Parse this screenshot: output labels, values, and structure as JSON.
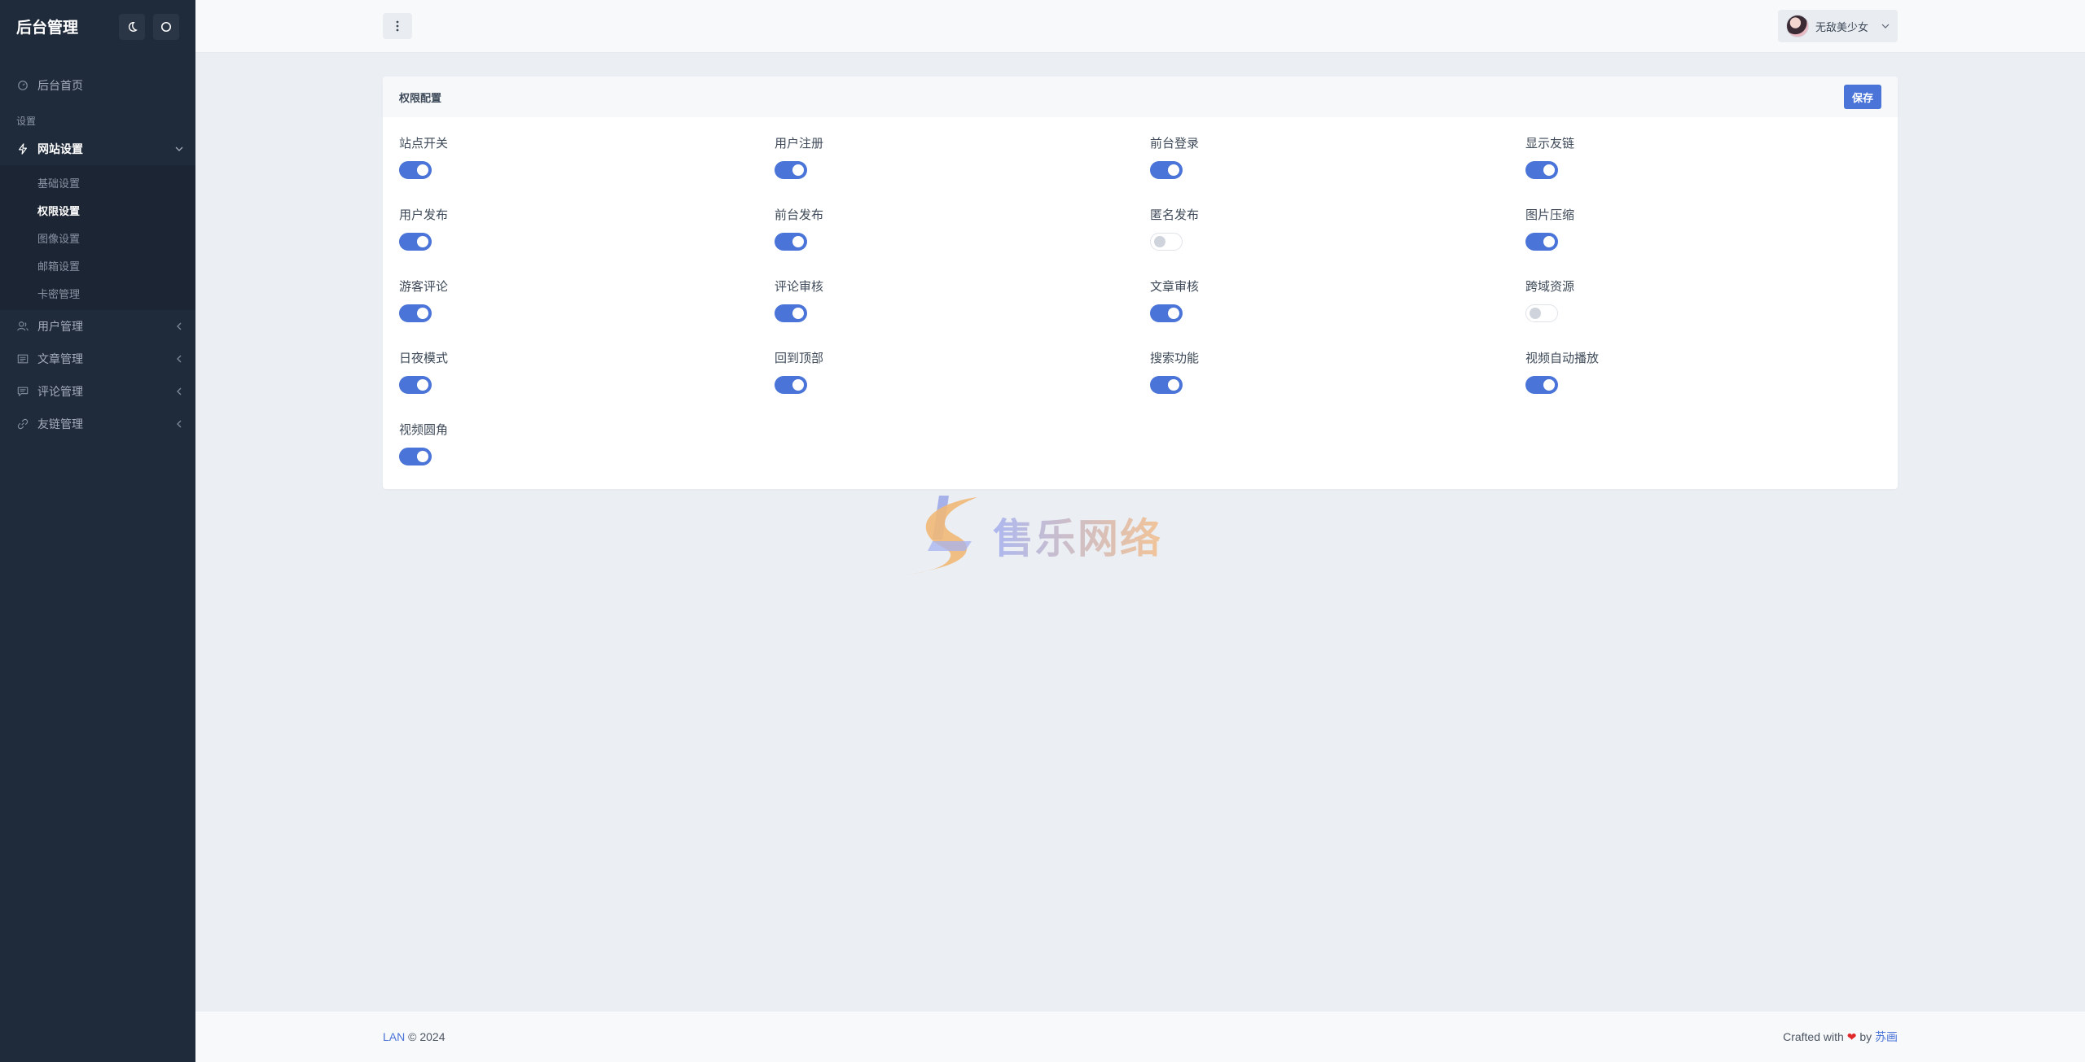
{
  "app": {
    "title": "后台管理"
  },
  "sidebar": {
    "home_label": "后台首页",
    "section_label": "设置",
    "site_settings": {
      "label": "网站设置",
      "children": [
        "基础设置",
        "权限设置",
        "图像设置",
        "邮箱设置",
        "卡密管理"
      ]
    },
    "groups": [
      {
        "label": "用户管理",
        "icon": "user-icon"
      },
      {
        "label": "文章管理",
        "icon": "article-icon"
      },
      {
        "label": "评论管理",
        "icon": "comment-icon"
      },
      {
        "label": "友链管理",
        "icon": "link-icon"
      }
    ]
  },
  "header": {
    "user_name": "无敌美少女"
  },
  "card": {
    "title": "权限配置",
    "save_label": "保存"
  },
  "options": [
    {
      "label": "站点开关",
      "on": true
    },
    {
      "label": "用户注册",
      "on": true
    },
    {
      "label": "前台登录",
      "on": true
    },
    {
      "label": "显示友链",
      "on": true
    },
    {
      "label": "用户发布",
      "on": true
    },
    {
      "label": "前台发布",
      "on": true
    },
    {
      "label": "匿名发布",
      "on": false
    },
    {
      "label": "图片压缩",
      "on": true
    },
    {
      "label": "游客评论",
      "on": true
    },
    {
      "label": "评论审核",
      "on": true
    },
    {
      "label": "文章审核",
      "on": true
    },
    {
      "label": "跨域资源",
      "on": false
    },
    {
      "label": "日夜模式",
      "on": true
    },
    {
      "label": "回到顶部",
      "on": true
    },
    {
      "label": "搜索功能",
      "on": true
    },
    {
      "label": "视频自动播放",
      "on": true
    },
    {
      "label": "视频圆角",
      "on": true
    }
  ],
  "watermark": {
    "text": "售乐网络"
  },
  "footer": {
    "brand": "LAN",
    "copyright": "© 2024",
    "crafted": "Crafted with",
    "heart": "❤",
    "by": "by",
    "author": "苏画"
  },
  "colors": {
    "accent": "#4a74d8",
    "sidebar_bg": "#1f2a3a",
    "page_bg": "#ebeef3"
  }
}
